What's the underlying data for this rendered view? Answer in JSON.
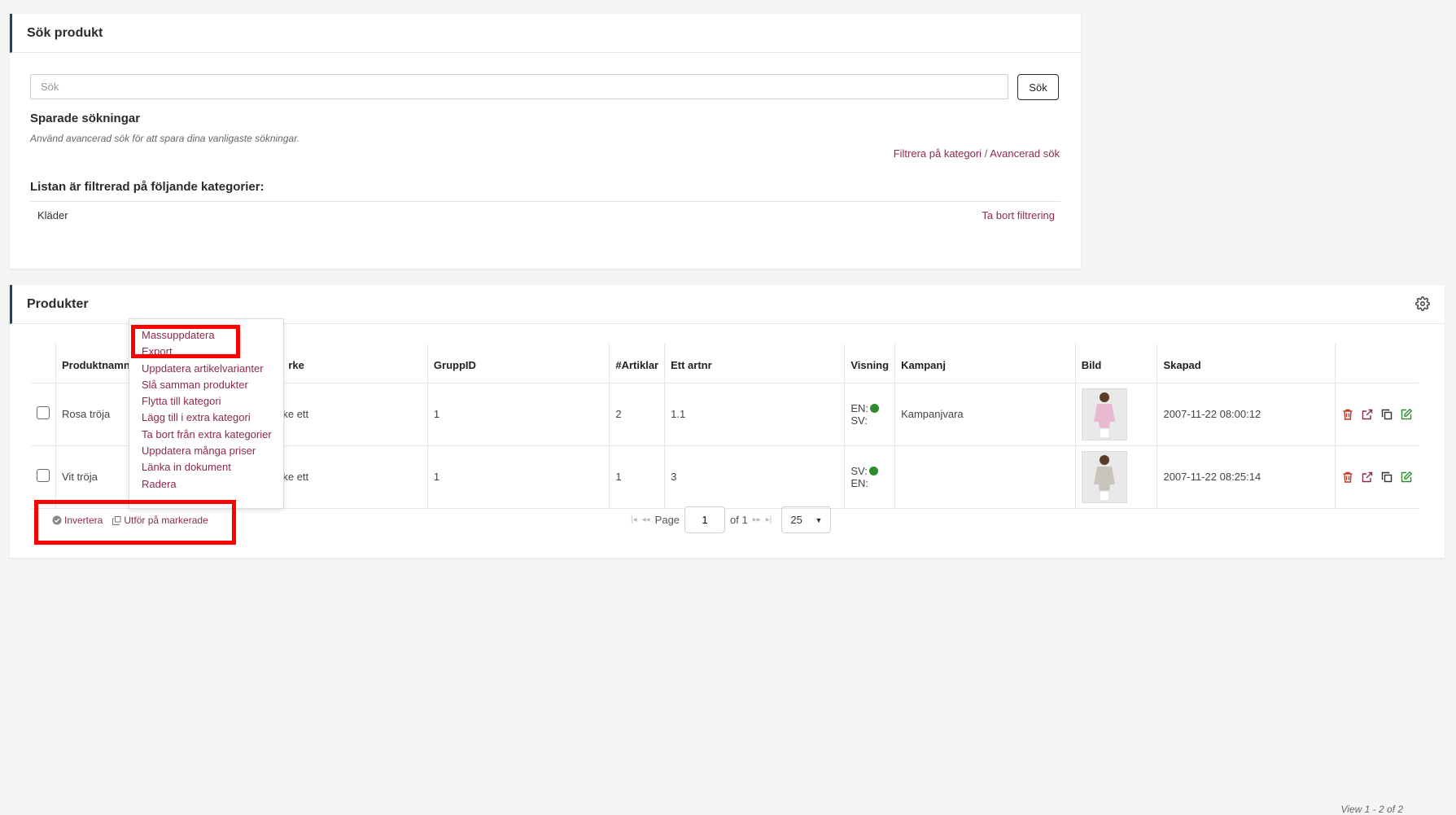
{
  "search_panel": {
    "title": "Sök produkt",
    "search_placeholder": "Sök",
    "search_button": "Sök",
    "saved_title": "Sparade sökningar",
    "saved_hint": "Använd avancerad sök för att spara dina vanligaste sökningar.",
    "filter_category_link": "Filtrera på kategori",
    "separator": "/",
    "advanced_search_link": "Avancerad sök",
    "filtered_title": "Listan är filtrerad på följande kategorier:",
    "filtered_category": "Kläder",
    "remove_filter_link": "Ta bort filtrering"
  },
  "products_panel": {
    "title": "Produkter",
    "settings_icon": "gear-icon",
    "columns": [
      "",
      "Produktnamn",
      "",
      "rke",
      "GruppID",
      "#Artiklar",
      "Ett artnr",
      "Visning",
      "Kampanj",
      "Bild",
      "Skapad",
      ""
    ],
    "rows": [
      {
        "name": "Rosa tröja",
        "brand": "ke ett",
        "group_id": "1",
        "articles": "2",
        "artnr": "1.1",
        "display_a": "EN:",
        "display_b": "SV:",
        "dot_after_a": true,
        "campaign": "Kampanjvara",
        "created": "2007-11-22 08:00:12",
        "shirt_color": "#e8b8d0"
      },
      {
        "name": "Vit tröja",
        "brand": "ke ett",
        "group_id": "1",
        "articles": "1",
        "artnr": "3",
        "display_a": "SV:",
        "display_b": "EN:",
        "dot_after_a": true,
        "campaign": "",
        "created": "2007-11-22 08:25:14",
        "shirt_color": "#c9c5bc"
      }
    ],
    "actions": [
      "trash-icon",
      "external-link-icon",
      "copy-icon",
      "edit-icon"
    ],
    "action_colors": {
      "delete": "#c0392b",
      "link": "#8b2a4a",
      "copy": "#333333",
      "edit": "#2e8b2e"
    }
  },
  "bulk_menu": {
    "items": [
      "Massuppdatera",
      "Export",
      "Uppdatera artikelvarianter",
      "Slå samman produkter",
      "Flytta till kategori",
      "Lägg till i extra kategori",
      "Ta bort från extra kategorier",
      "Uppdatera många priser",
      "Länka in dokument",
      "Radera"
    ]
  },
  "footer": {
    "invert_label": "Invertera",
    "apply_label": "Utför på markerade",
    "page_label": "Page",
    "page_value": "1",
    "of_label": "of 1",
    "page_size": "25",
    "view_text": "View 1 - 2 of 2"
  },
  "colors": {
    "accent": "#8b2a4a",
    "highlight": "#ff0000",
    "status_green": "#2e8b2e",
    "header_bar": "#2f3d55"
  }
}
